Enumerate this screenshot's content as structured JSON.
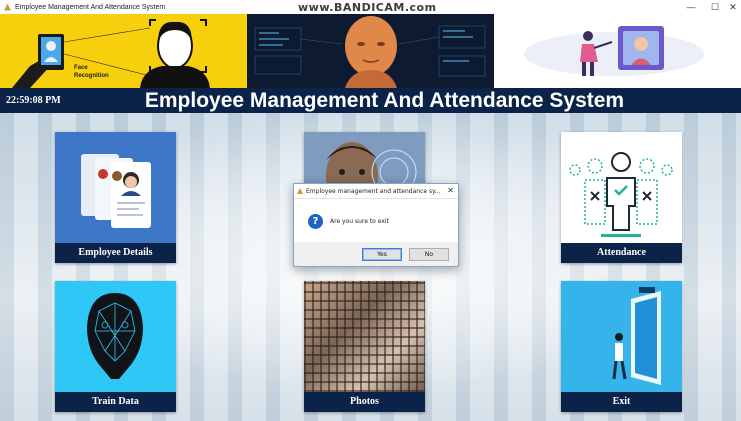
{
  "window": {
    "title": "Employee Management And Attendance System",
    "minimize": "—",
    "maximize": "☐",
    "close": "✕"
  },
  "watermark": "www.BANDICAM.com",
  "banner": {
    "caption": "Face Recognition"
  },
  "header": {
    "clock": "22:59:08 PM",
    "title": "Employee Management And Attendance System"
  },
  "tiles": {
    "employee_details": "Employee Details",
    "detect_face": "",
    "attendance": "Attendance",
    "train_data": "Train Data",
    "photos": "Photos",
    "exit": "Exit"
  },
  "dialog": {
    "title": "Employee management and attendance sy...",
    "close": "✕",
    "message": "Are you sure to exit",
    "yes": "Yes",
    "no": "No"
  },
  "colors": {
    "header_bg": "#0c2349",
    "banner_yellow": "#f6cf0d",
    "tile_blue": "#3f77c8",
    "tile_cyan": "#2fc7f6"
  }
}
